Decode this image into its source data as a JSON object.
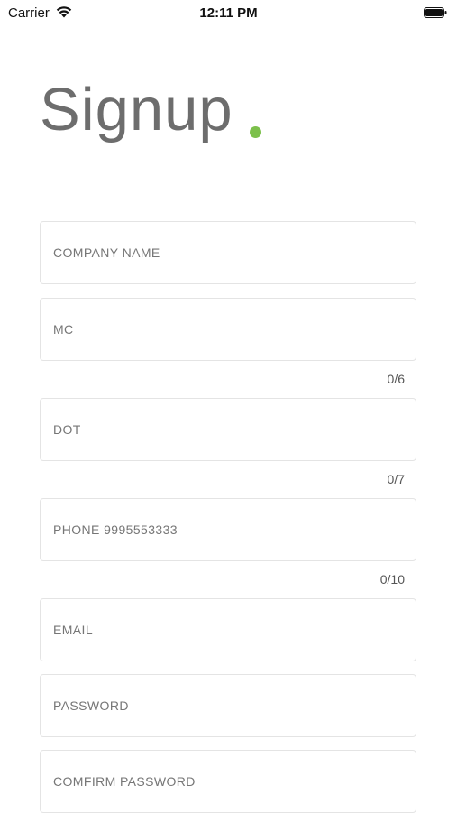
{
  "status_bar": {
    "carrier": "Carrier",
    "time": "12:11 PM",
    "wifi_icon": "wifi-icon",
    "battery_icon": "battery-full-icon"
  },
  "header": {
    "title": "Signup",
    "dot_color": "#7cc04b"
  },
  "form": {
    "company_name": {
      "placeholder": "COMPANY NAME",
      "value": ""
    },
    "mc": {
      "placeholder": "MC",
      "value": "",
      "counter": "0/6"
    },
    "dot": {
      "placeholder": "DOT",
      "value": "",
      "counter": "0/7"
    },
    "phone": {
      "placeholder": "PHONE 9995553333",
      "value": "",
      "counter": "0/10"
    },
    "email": {
      "placeholder": "EMAIL",
      "value": ""
    },
    "password": {
      "placeholder": "PASSWORD",
      "value": ""
    },
    "confirm_password": {
      "placeholder": "COMFIRM PASSWORD",
      "value": ""
    }
  }
}
